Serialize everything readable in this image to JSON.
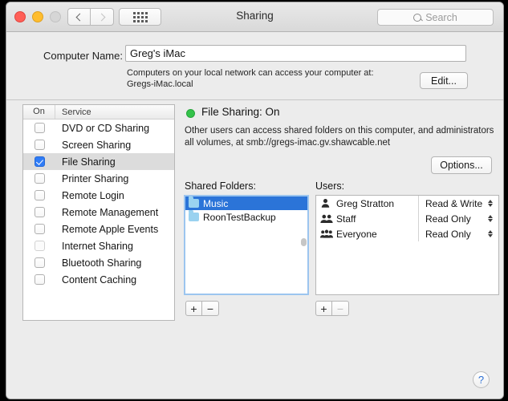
{
  "window": {
    "title": "Sharing",
    "traffic_lights": [
      "close",
      "minimize",
      "zoom"
    ],
    "back_icon": "chevron-left-icon",
    "forward_icon": "chevron-right-icon",
    "grid_icon": "show-all-grid-icon",
    "search": {
      "placeholder": "Search",
      "value": "",
      "icon": "search-icon"
    }
  },
  "computer_name": {
    "label": "Computer Name:",
    "value": "Greg's iMac",
    "hint_line1": "Computers on your local network can access your computer at:",
    "hint_line2": "Gregs-iMac.local",
    "edit_label": "Edit..."
  },
  "service_list": {
    "header_on": "On",
    "header_service": "Service",
    "rows": [
      {
        "name": "DVD or CD Sharing",
        "checked": false,
        "selected": false,
        "disabled": false
      },
      {
        "name": "Screen Sharing",
        "checked": false,
        "selected": false,
        "disabled": false
      },
      {
        "name": "File Sharing",
        "checked": true,
        "selected": true,
        "disabled": false
      },
      {
        "name": "Printer Sharing",
        "checked": false,
        "selected": false,
        "disabled": false
      },
      {
        "name": "Remote Login",
        "checked": false,
        "selected": false,
        "disabled": false
      },
      {
        "name": "Remote Management",
        "checked": false,
        "selected": false,
        "disabled": false
      },
      {
        "name": "Remote Apple Events",
        "checked": false,
        "selected": false,
        "disabled": false
      },
      {
        "name": "Internet Sharing",
        "checked": false,
        "selected": false,
        "disabled": true
      },
      {
        "name": "Bluetooth Sharing",
        "checked": false,
        "selected": false,
        "disabled": false
      },
      {
        "name": "Content Caching",
        "checked": false,
        "selected": false,
        "disabled": false
      }
    ]
  },
  "status": {
    "indicator_color": "#34c24a",
    "title": "File Sharing: On",
    "description_line1": "Other users can access shared folders on this computer, and administrators",
    "description_line2": "all volumes, at smb://gregs-imac.gv.shawcable.net",
    "options_label": "Options..."
  },
  "shared_folders": {
    "label": "Shared Folders:",
    "items": [
      {
        "name": "Music",
        "selected": true
      },
      {
        "name": "RoonTestBackup",
        "selected": false
      }
    ],
    "add_label": "+",
    "remove_label": "−"
  },
  "users": {
    "label": "Users:",
    "items": [
      {
        "name": "Greg Stratton",
        "icon": "single-user-icon",
        "permission": "Read & Write"
      },
      {
        "name": "Staff",
        "icon": "group-pair-icon",
        "permission": "Read Only"
      },
      {
        "name": "Everyone",
        "icon": "everyone-group-icon",
        "permission": "Read Only"
      }
    ],
    "add_label": "+",
    "remove_label": "−"
  },
  "help": {
    "label": "?"
  }
}
